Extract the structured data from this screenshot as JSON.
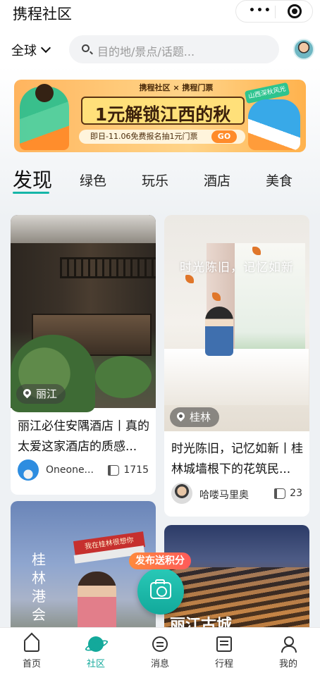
{
  "app": {
    "title": "携程社区"
  },
  "capsule": {
    "more_icon": "ellipsis-icon",
    "close_icon": "record-icon"
  },
  "header": {
    "region": "全球",
    "search_placeholder": "目的地/景点/话题..."
  },
  "banner": {
    "brand_line": "携程社区 × 携程门票",
    "headline": "1元解锁江西的秋",
    "subline": "即日-11.06免费报名抽1元门票",
    "go_label": "GO",
    "corner_tag": "山西深秋风光榜"
  },
  "tabs": [
    {
      "label": "发现"
    },
    {
      "label": "绿色"
    },
    {
      "label": "玩乐"
    },
    {
      "label": "酒店"
    },
    {
      "label": "美食"
    }
  ],
  "feed": {
    "left": [
      {
        "location": "丽江",
        "title": "丽江必住安隅酒店丨真的太爱这家酒店的质感...",
        "author": "Oneone...",
        "likes": "1715"
      },
      {
        "overlay_text": "桂林 港会",
        "sign_text": "我在桂林很想你"
      }
    ],
    "right": [
      {
        "location": "桂林",
        "overlay_text": "时光陈旧，记忆如新",
        "title": "时光陈旧，记忆如新丨桂林城墙根下的花筑民...",
        "author": "哈喽马里奥",
        "likes": "23"
      },
      {
        "overlay_text": "丽江古城"
      }
    ]
  },
  "publish": {
    "badge": "发布送积分"
  },
  "bottom_nav": [
    {
      "label": "首页",
      "icon": "home-icon"
    },
    {
      "label": "社区",
      "icon": "planet-icon"
    },
    {
      "label": "消息",
      "icon": "message-icon"
    },
    {
      "label": "行程",
      "icon": "itinerary-icon"
    },
    {
      "label": "我的",
      "icon": "profile-icon"
    }
  ],
  "colors": {
    "accent": "#13a99b",
    "publish_badge": "#ff6a45"
  }
}
